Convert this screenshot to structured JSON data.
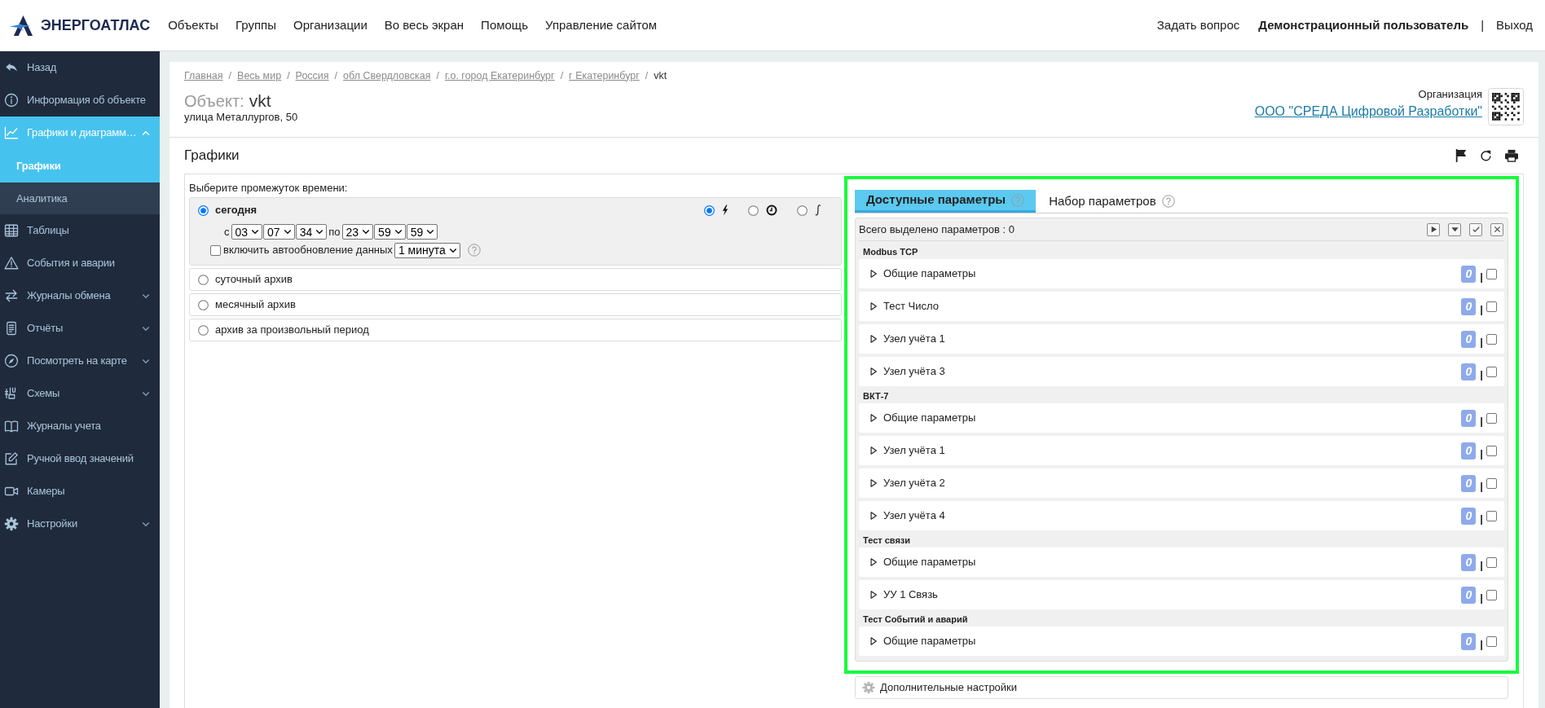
{
  "header": {
    "logo": "ЭНЕРГОАТЛАС",
    "nav": [
      "Объекты",
      "Группы",
      "Организации",
      "Во весь экран",
      "Помощь",
      "Управление сайтом"
    ],
    "links": [
      {
        "kind": "link",
        "label": "Задать вопрос"
      },
      {
        "kind": "user",
        "label": "Демонстрационный пользователь"
      },
      {
        "kind": "separator",
        "label": "|"
      },
      {
        "kind": "link",
        "label": "Выход"
      }
    ]
  },
  "sidebar": {
    "items": [
      {
        "label": "Назад",
        "kind": "link",
        "selected": false
      },
      {
        "label": "Информация об объекте",
        "kind": "link",
        "selected": false
      },
      {
        "label": "Графики и диаграмм…",
        "kind": "group",
        "selected": true,
        "expanded": true,
        "children": [
          {
            "label": "Графики",
            "selected": true
          },
          {
            "label": "Аналитика",
            "selected": false
          }
        ]
      },
      {
        "label": "Таблицы",
        "kind": "link",
        "selected": false
      },
      {
        "label": "События и аварии",
        "kind": "link",
        "selected": false
      },
      {
        "label": "Журналы обмена",
        "kind": "group",
        "selected": false,
        "expanded": false
      },
      {
        "label": "Отчёты",
        "kind": "group",
        "selected": false,
        "expanded": false
      },
      {
        "label": "Посмотреть на карте",
        "kind": "group",
        "selected": false,
        "expanded": false
      },
      {
        "label": "Схемы",
        "kind": "group",
        "selected": false,
        "expanded": false
      },
      {
        "label": "Журналы учета",
        "kind": "link",
        "selected": false
      },
      {
        "label": "Ручной ввод значений",
        "kind": "link",
        "selected": false
      },
      {
        "label": "Камеры",
        "kind": "link",
        "selected": false
      },
      {
        "label": "Настройки",
        "kind": "group",
        "selected": false,
        "expanded": false
      }
    ]
  },
  "page": {
    "breadcrumb": [
      {
        "kind": "link",
        "label": "Главная"
      },
      {
        "kind": "separator",
        "label": "/"
      },
      {
        "kind": "link",
        "label": "Весь мир"
      },
      {
        "kind": "separator",
        "label": "/"
      },
      {
        "kind": "link",
        "label": "Россия"
      },
      {
        "kind": "separator",
        "label": "/"
      },
      {
        "kind": "link",
        "label": "обл Свердловская"
      },
      {
        "kind": "separator",
        "label": "/"
      },
      {
        "kind": "link",
        "label": "г.о. город Екатеринбург"
      },
      {
        "kind": "separator",
        "label": "/"
      },
      {
        "kind": "link",
        "label": "г Екатеринбург"
      },
      {
        "kind": "separator",
        "label": "/"
      },
      {
        "kind": "current",
        "label": "vkt"
      }
    ],
    "object": {
      "label": "Объект:",
      "name": "vkt",
      "address": "улица Металлургов, 50"
    },
    "organization": {
      "label": "Организация",
      "name": "ООО \"СРЕДА Цифровой Разработки\""
    }
  },
  "section": {
    "title": "Графики"
  },
  "time_range": {
    "prompt": "Выберите промежуток времени:",
    "options": [
      {
        "label": "сегодня",
        "selected": true,
        "from_label": "с",
        "from": [
          "03",
          "07",
          "34"
        ],
        "to_label": "по",
        "to": [
          "23",
          "59",
          "59"
        ],
        "autoupdate": {
          "label": "включить автообновление данных",
          "checked": false,
          "interval": "1 минута"
        },
        "modes": [
          {
            "selected": true
          },
          {
            "selected": false
          },
          {
            "selected": false
          }
        ]
      },
      {
        "label": "суточный архив",
        "selected": false
      },
      {
        "label": "месячный архив",
        "selected": false
      },
      {
        "label": "архив за произвольный период",
        "selected": false
      }
    ]
  },
  "parameters": {
    "tabs": [
      {
        "label": "Доступные параметры",
        "selected": true
      },
      {
        "label": "Набор параметров",
        "selected": false
      }
    ],
    "summary": "Всего выделено параметров : 0",
    "groups": [
      {
        "title": "Modbus TCP",
        "items": [
          {
            "label": "Общие параметры",
            "count": "0",
            "separator": "|",
            "checked": false,
            "expanded": false
          },
          {
            "label": "Тест Число",
            "count": "0",
            "separator": "|",
            "checked": false,
            "expanded": false
          },
          {
            "label": "Узел учёта 1",
            "count": "0",
            "separator": "|",
            "checked": false,
            "expanded": false
          },
          {
            "label": "Узел учёта 3",
            "count": "0",
            "separator": "|",
            "checked": false,
            "expanded": false
          }
        ]
      },
      {
        "title": "ВКТ-7",
        "items": [
          {
            "label": "Общие параметры",
            "count": "0",
            "separator": "|",
            "checked": false,
            "expanded": false
          },
          {
            "label": "Узел учёта 1",
            "count": "0",
            "separator": "|",
            "checked": false,
            "expanded": false
          },
          {
            "label": "Узел учёта 2",
            "count": "0",
            "separator": "|",
            "checked": false,
            "expanded": false
          },
          {
            "label": "Узел учёта 4",
            "count": "0",
            "separator": "|",
            "checked": false,
            "expanded": false
          }
        ]
      },
      {
        "title": "Тест связи",
        "items": [
          {
            "label": "Общие параметры",
            "count": "0",
            "separator": "|",
            "checked": false,
            "expanded": false
          },
          {
            "label": "УУ 1 Связь",
            "count": "0",
            "separator": "|",
            "checked": false,
            "expanded": false
          }
        ]
      },
      {
        "title": "Тест Событий и аварий",
        "items": [
          {
            "label": "Общие параметры",
            "count": "0",
            "separator": "|",
            "checked": false,
            "expanded": false
          }
        ]
      }
    ]
  },
  "extra_settings": {
    "label": "Дополнительные настройки"
  }
}
